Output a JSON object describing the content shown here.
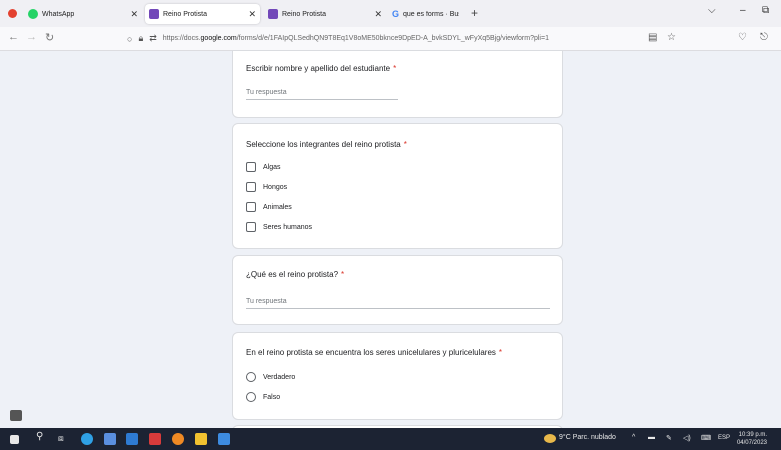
{
  "browser": {
    "tabs": [
      {
        "label": "WhatsApp",
        "color": "#25d366"
      },
      {
        "label": "Reino Protista",
        "color": "#7248b9"
      },
      {
        "label": "Reino Protista",
        "color": "#7248b9"
      },
      {
        "label": "que es forms · Buscar con Goo...",
        "color": "#4285f4"
      }
    ],
    "url_prefix": "https://docs.",
    "url_host": "google.com",
    "url_path": "/forms/d/e/1FAIpQLSedhQN9T8Eq1V8oME50bknce9DpED-A_bvkSDYL_wFyXq5Bjg/viewform?pli=1"
  },
  "form": {
    "q1": {
      "title": "Escribir nombre y apellido del estudiante",
      "required": "*",
      "placeholder": "Tu respuesta"
    },
    "q2": {
      "title": "Seleccione los integrantes del reino protista",
      "required": "*",
      "options": [
        "Algas",
        "Hongos",
        "Animales",
        "Seres humanos"
      ]
    },
    "q3": {
      "title": "¿Qué es el reino protista?",
      "required": "*",
      "placeholder": "Tu respuesta"
    },
    "q4": {
      "title": "En el reino protista se encuentra los seres unicelulares y pluricelulares",
      "required": "*",
      "options": [
        "Verdadero",
        "Falso"
      ]
    }
  },
  "taskbar": {
    "weather": "9°C Parc. nublado",
    "lang": "ESP",
    "time": "10:39 p.m.",
    "date": "04/07/2023"
  }
}
